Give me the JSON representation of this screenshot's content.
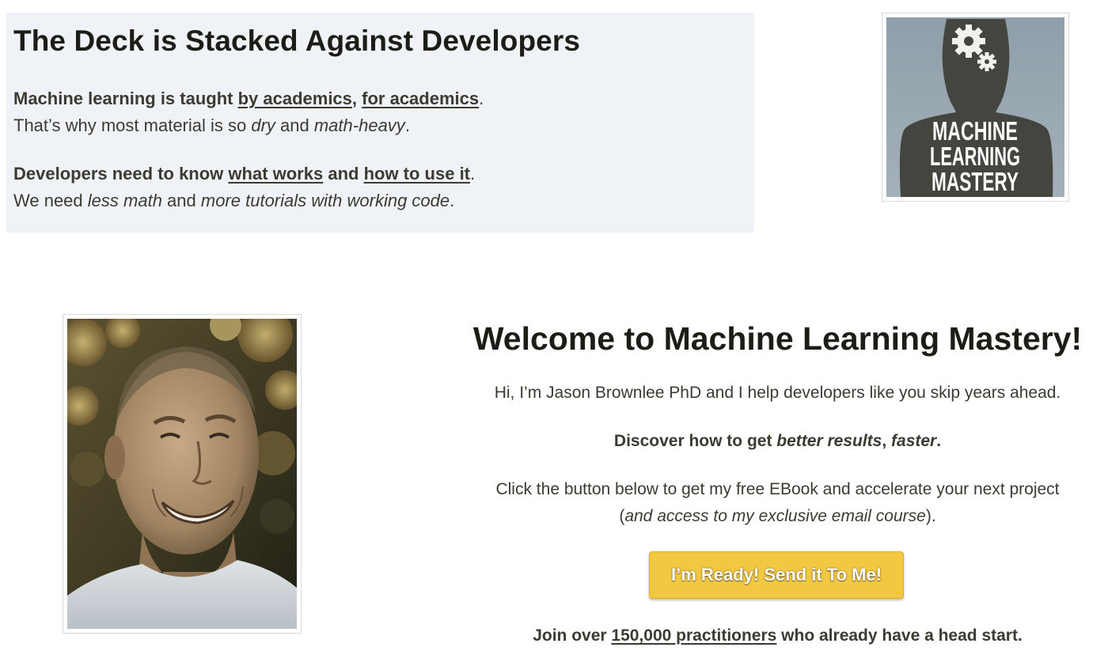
{
  "deck": {
    "title": "The Deck is Stacked Against Developers",
    "para1": {
      "bold_prefix": "Machine learning is taught ",
      "link1": "by academics",
      "sep": ", ",
      "link2": "for academics",
      "end": ".",
      "line2_a": "That’s why most material is so ",
      "line2_em1": "dry",
      "line2_b": " and ",
      "line2_em2": "math-heavy",
      "line2_end": "."
    },
    "para2": {
      "bold_prefix": "Developers need to know ",
      "link1": "what works",
      "sep": " and ",
      "link2": "how to use it",
      "end": ".",
      "line2_a": "We need ",
      "line2_em1": "less math",
      "line2_b": " and ",
      "line2_em2": "more tutorials with working code",
      "line2_end": "."
    }
  },
  "logo": {
    "lines": [
      "MACHINE",
      "LEARNING",
      "MASTERY"
    ],
    "icon": "gears-icon",
    "colors": {
      "background": "#94a3ad",
      "silhouette": "#43443e",
      "text": "#ffffff"
    }
  },
  "portrait": {
    "icon": "author-portrait"
  },
  "welcome": {
    "title": "Welcome to Machine Learning Mastery!",
    "intro": "Hi, I’m Jason Brownlee PhD and I help developers like you skip years ahead.",
    "discover_a": "Discover how to get ",
    "discover_em1": "better results",
    "discover_sep": ", ",
    "discover_em2": "faster",
    "discover_end": ".",
    "click_line1": "Click the button below to get my free EBook and accelerate your next project",
    "click_line2_open": "(",
    "click_line2_em": "and access to my exclusive email course",
    "click_line2_close": ").",
    "cta_label": "I’m Ready! Send it To Me!",
    "join_a": "Join over ",
    "join_link": "150,000 practitioners",
    "join_b": " who already have a head start."
  },
  "colors": {
    "panel_bg": "#eff3f7",
    "text": "#3b3b32",
    "heading": "#1d1d17",
    "cta_bg": "#f2c741"
  }
}
